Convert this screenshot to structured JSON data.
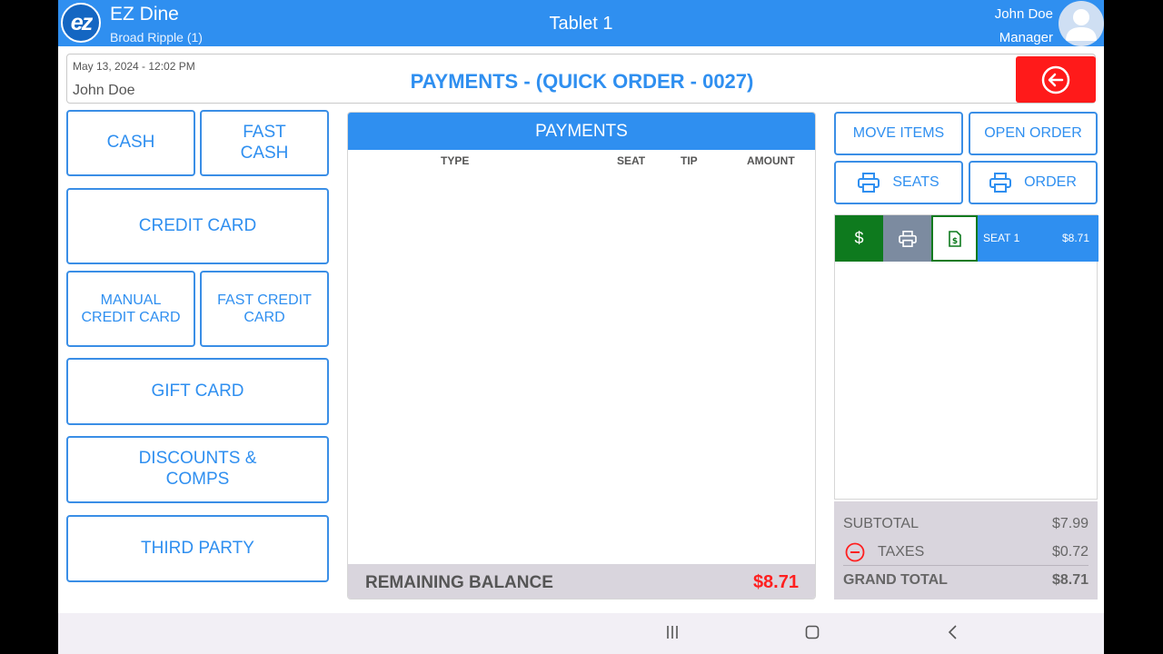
{
  "app": {
    "name": "EZ Dine",
    "logo_text": "ez",
    "location": "Broad Ripple (1)",
    "device": "Tablet 1",
    "user_name": "John Doe",
    "user_role": "Manager"
  },
  "header": {
    "datetime": "May 13, 2024 - 12:02 PM",
    "user": "John Doe",
    "title": "PAYMENTS - (QUICK ORDER - 0027)"
  },
  "payment_buttons": {
    "cash": "CASH",
    "fast_cash": "FAST CASH",
    "credit_card": "CREDIT CARD",
    "manual_credit_card": "MANUAL CREDIT CARD",
    "fast_credit_card": "FAST CREDIT CARD",
    "gift_card": "GIFT CARD",
    "discounts_comps": "DISCOUNTS & COMPS",
    "third_party": "THIRD PARTY"
  },
  "payments": {
    "title": "PAYMENTS",
    "columns": [
      "TYPE",
      "SEAT",
      "TIP",
      "AMOUNT"
    ],
    "rows": [],
    "remaining_label": "REMAINING BALANCE",
    "remaining_value": "$8.71"
  },
  "actions": {
    "move_items": "MOVE ITEMS",
    "open_order": "OPEN ORDER",
    "print_seats": "SEATS",
    "print_order": "ORDER"
  },
  "seats": [
    {
      "label": "SEAT 1",
      "amount": "$8.71"
    }
  ],
  "totals": {
    "subtotal_label": "SUBTOTAL",
    "subtotal": "$7.99",
    "taxes_label": "TAXES",
    "taxes": "$0.72",
    "grand_total_label": "GRAND TOTAL",
    "grand_total": "$8.71"
  },
  "colors": {
    "primary": "#2f8ff0",
    "danger": "#ff1a1a",
    "success": "#0e7a1e",
    "panel_grey": "#d9d5dd"
  },
  "icons": {
    "back": "circle-arrow-left-icon",
    "print": "printer-icon",
    "pay": "dollar-icon",
    "receipt": "receipt-dollar-icon",
    "tax_remove": "minus-circle-icon"
  }
}
